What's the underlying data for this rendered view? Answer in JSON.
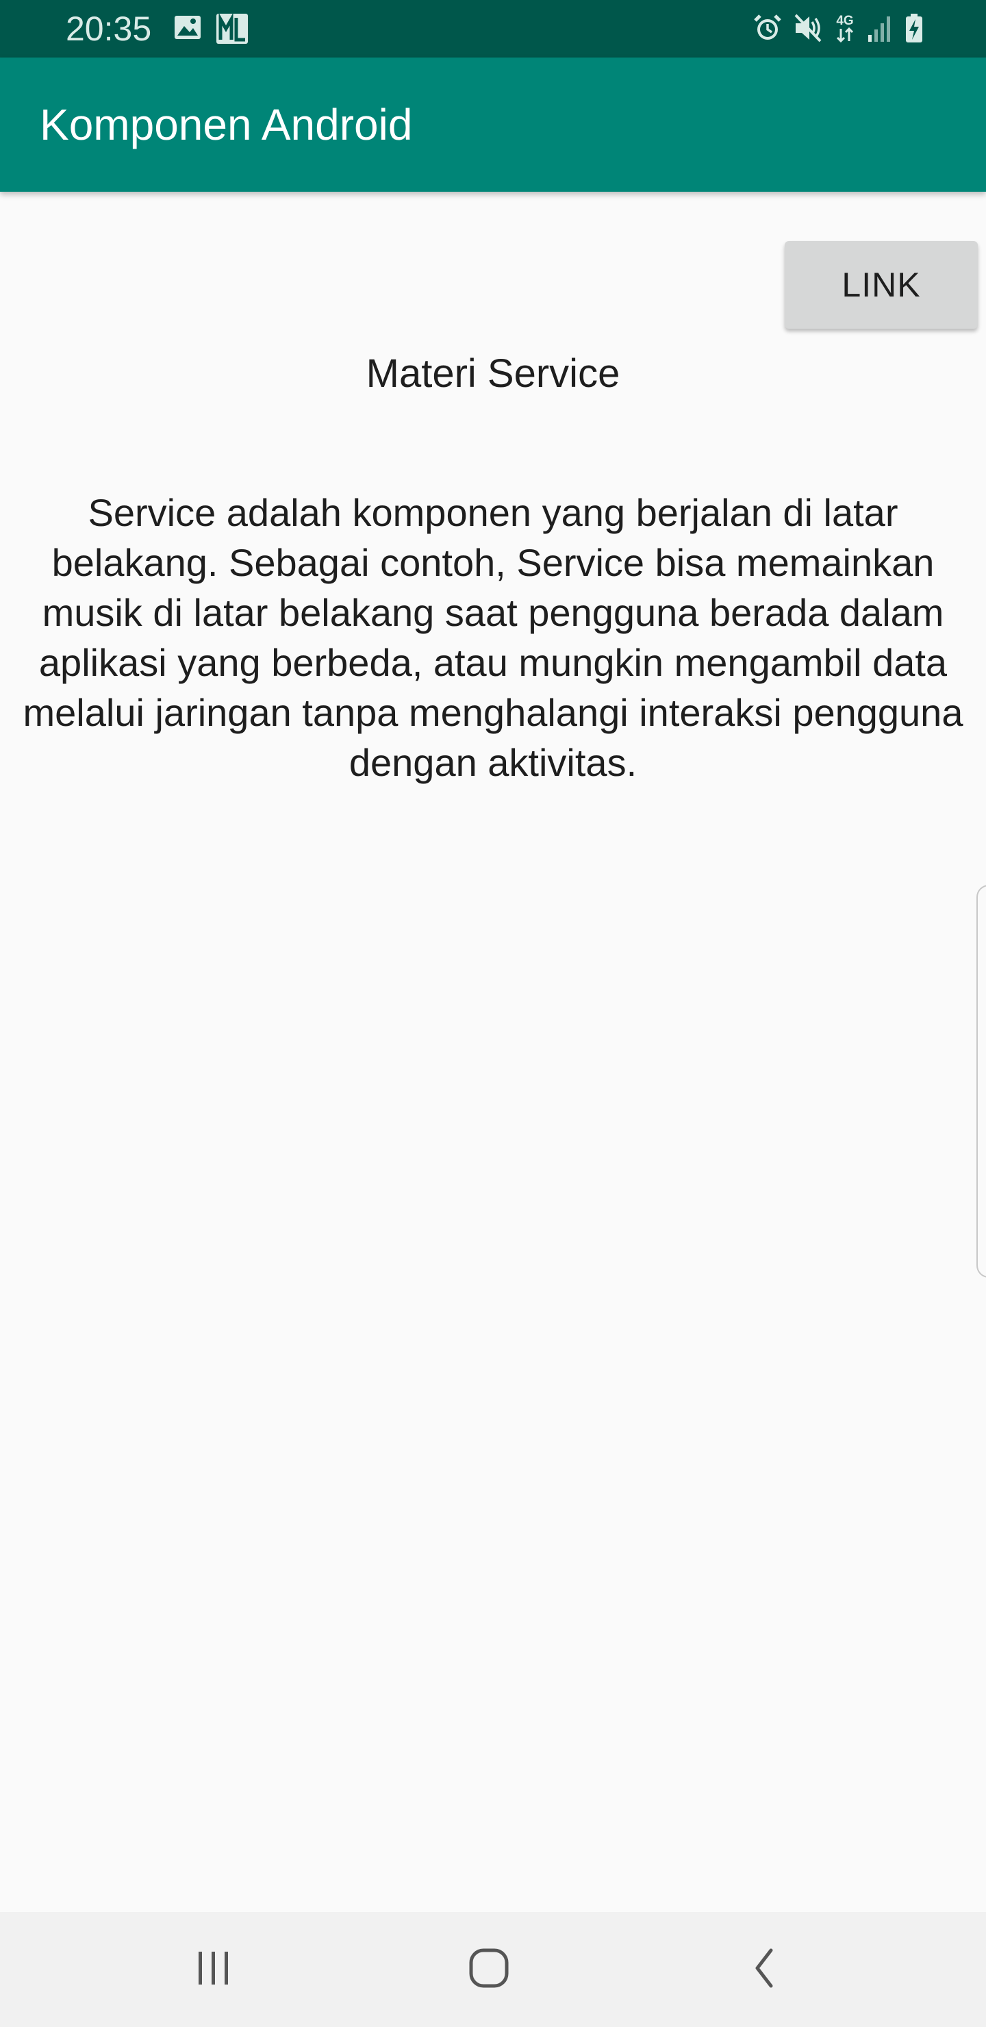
{
  "status_bar": {
    "time": "20:35",
    "left_icons": [
      "image-icon",
      "ml-app-icon"
    ],
    "right_icons": [
      "alarm-icon",
      "mute-icon",
      "4g-icon",
      "signal-icon",
      "battery-charging-icon"
    ],
    "network_label": "4G"
  },
  "app_bar": {
    "title": "Komponen Android",
    "background": "#008577"
  },
  "content": {
    "link_button_label": "LINK",
    "topic_title": "Materi Service",
    "topic_body": "Service adalah komponen yang berjalan di latar belakang. Sebagai contoh, Service bisa memainkan musik di latar belakang saat pengguna berada dalam aplikasi yang berbeda, atau mungkin mengambil data melalui jaringan tanpa menghalangi interaksi pengguna dengan aktivitas."
  },
  "nav_bar": {
    "buttons": [
      "recents-icon",
      "home-icon",
      "back-icon"
    ]
  }
}
